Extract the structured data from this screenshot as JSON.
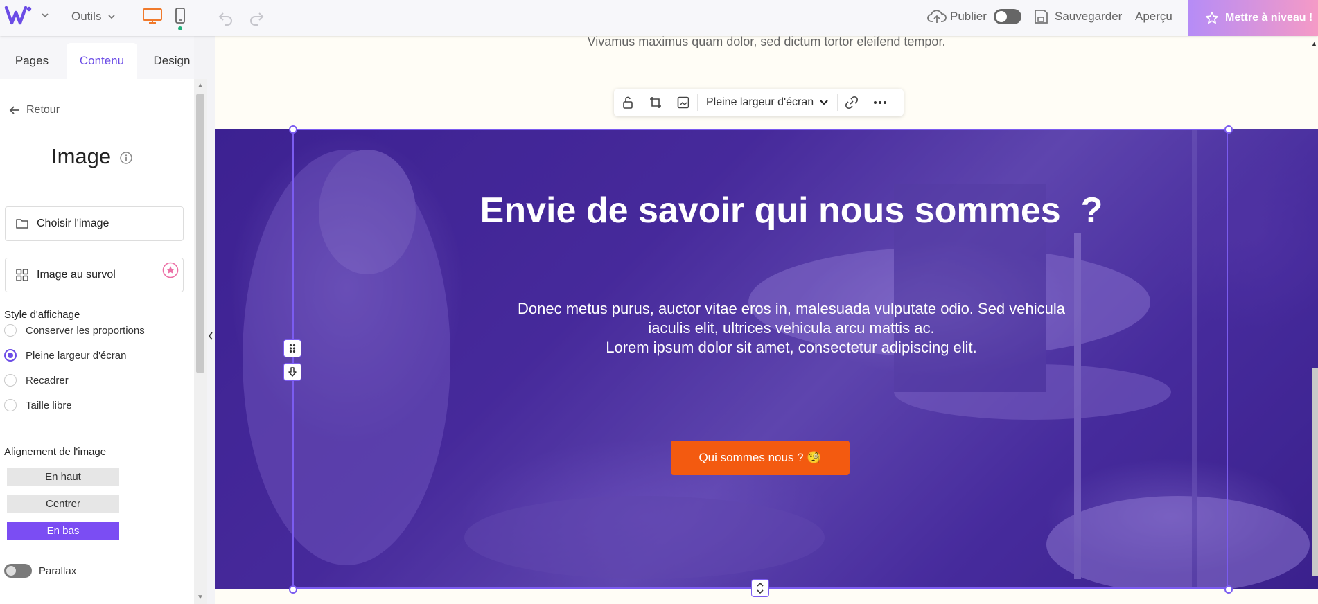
{
  "topbar": {
    "tools_label": "Outils",
    "publish_label": "Publier",
    "save_label": "Sauvegarder",
    "preview_label": "Aperçu",
    "upgrade_label": "Mettre à niveau !"
  },
  "sidebar": {
    "tabs": [
      "Pages",
      "Contenu",
      "Design"
    ],
    "active_tab": "Contenu",
    "back_label": "Retour",
    "title": "Image",
    "choose_image_label": "Choisir l'image",
    "hover_image_label": "Image au survol",
    "display_style_label": "Style d'affichage",
    "display_options": [
      "Conserver les proportions",
      "Pleine largeur d'écran",
      "Recadrer",
      "Taille libre"
    ],
    "selected_display": "Pleine largeur d'écran",
    "alignment_label": "Alignement de l'image",
    "alignment_options": [
      "En haut",
      "Centrer",
      "En bas"
    ],
    "selected_alignment": "En bas",
    "parallax_label": "Parallax"
  },
  "canvas": {
    "top_text": "Vivamus maximus quam dolor, sed dictum tortor eleifend tempor.",
    "toolbar": {
      "width_mode": "Pleine largeur d'écran"
    },
    "hero": {
      "heading": "Envie de savoir qui nous sommes  ?",
      "paragraph_line1": "Donec metus purus, auctor vitae eros in, malesuada vulputate odio. Sed vehicula",
      "paragraph_line2": "iaculis elit, ultrices vehicula arcu mattis ac.",
      "paragraph_line3": "Lorem ipsum dolor sit amet, consectetur adipiscing elit.",
      "cta_label": "Qui sommes nous ? 🧐"
    }
  },
  "colors": {
    "accent": "#6c4de6",
    "cta": "#f35a10",
    "hero_overlay": "#4a2d9c",
    "device_active": "#f07a2c"
  }
}
